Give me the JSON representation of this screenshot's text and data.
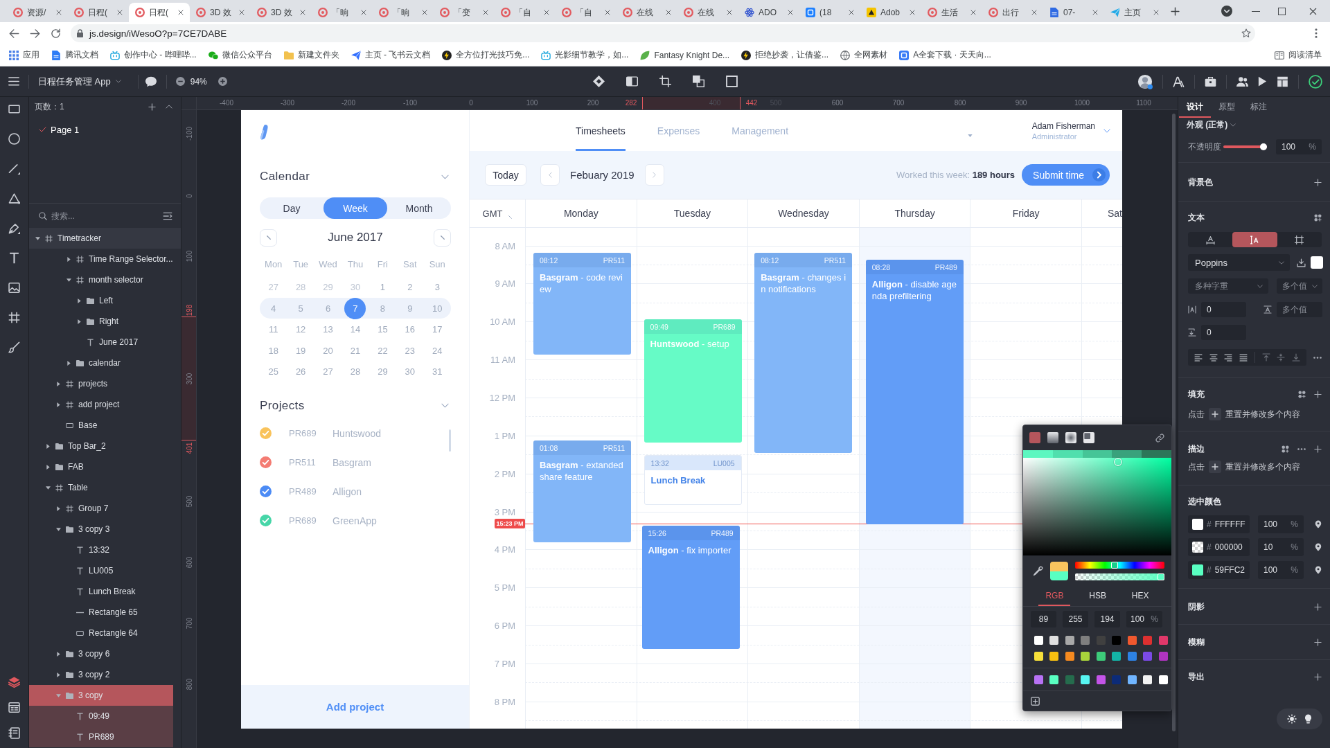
{
  "browser": {
    "tabs": [
      {
        "title": "资源/",
        "kind": "ring",
        "selected": false
      },
      {
        "title": "日程(",
        "kind": "ring",
        "selected": false
      },
      {
        "title": "日程(",
        "kind": "ring",
        "selected": true
      },
      {
        "title": "3D 效",
        "kind": "ring",
        "selected": false
      },
      {
        "title": "3D 效",
        "kind": "ring",
        "selected": false
      },
      {
        "title": "「晌",
        "kind": "ring",
        "selected": false
      },
      {
        "title": "「晌",
        "kind": "ring",
        "selected": false
      },
      {
        "title": "「变",
        "kind": "ring",
        "selected": false
      },
      {
        "title": "「自",
        "kind": "ring",
        "selected": false
      },
      {
        "title": "「自",
        "kind": "ring",
        "selected": false
      },
      {
        "title": "在线",
        "kind": "ring",
        "selected": false
      },
      {
        "title": "在线",
        "kind": "ring",
        "selected": false
      },
      {
        "title": "ADO",
        "kind": "atom",
        "selected": false
      },
      {
        "title": "(18",
        "kind": "square",
        "selected": false
      },
      {
        "title": "Adob",
        "kind": "sketch",
        "selected": false
      },
      {
        "title": "生活",
        "kind": "ring",
        "selected": false
      },
      {
        "title": "出行",
        "kind": "ring",
        "selected": false
      },
      {
        "title": "07-",
        "kind": "doc",
        "selected": false
      },
      {
        "title": "主页",
        "kind": "plane",
        "selected": false
      }
    ],
    "url": "js.design/iWesoO?p=7CE7DABE",
    "bookmarks": [
      {
        "label": "应用",
        "kind": "apps"
      },
      {
        "label": "腾讯文档",
        "kind": "doc"
      },
      {
        "label": "创作中心 - 哔哩哔...",
        "kind": "tv"
      },
      {
        "label": "微信公众平台",
        "kind": "chat"
      },
      {
        "label": "新建文件夹",
        "kind": "folder"
      },
      {
        "label": "主页 - 飞书云文档",
        "kind": "plane"
      },
      {
        "label": "全方位打光技巧免...",
        "kind": "bolt"
      },
      {
        "label": "光影细节教学，如...",
        "kind": "tv"
      },
      {
        "label": "Fantasy Knight De...",
        "kind": "leaf"
      },
      {
        "label": "拒绝抄袭，让借鉴...",
        "kind": "bolt"
      },
      {
        "label": "全网素材",
        "kind": "globe"
      },
      {
        "label": "A全套下载 · 天天向...",
        "kind": "square"
      }
    ],
    "reading_list": "阅读清单"
  },
  "app_bar": {
    "file_name": "日程任务管理 App",
    "zoom": "94%"
  },
  "panels": [
    {
      "kind": "layers",
      "selected": true
    },
    {
      "kind": "assets",
      "selected": false
    },
    {
      "kind": "notes",
      "selected": false
    }
  ],
  "layers_panel": {
    "pages_label": "页数：1",
    "pages": [
      {
        "label": "Page 1",
        "selected": true
      }
    ],
    "search_placeholder": "搜索...",
    "tree": [
      {
        "label": "Timetracker",
        "kind": "frame",
        "expanded": true,
        "selected": false,
        "children": [
          {
            "children": [
              {
                "children": [
                  {
                    "label": "Time Range Selector...",
                    "kind": "frame",
                    "expanded": false,
                    "selected": false
                  },
                  {
                    "label": "month selector",
                    "kind": "frame",
                    "expanded": true,
                    "selected": false,
                    "children": [
                      {
                        "label": "Left",
                        "kind": "folder",
                        "expanded": false,
                        "selected": false
                      },
                      {
                        "label": "Right",
                        "kind": "folder",
                        "expanded": false,
                        "selected": false
                      },
                      {
                        "label": "June 2017",
                        "kind": "text",
                        "selected": false
                      }
                    ]
                  },
                  {
                    "label": "calendar",
                    "kind": "folder",
                    "expanded": false,
                    "selected": false
                  }
                ]
              },
              {
                "label": "projects",
                "kind": "frame",
                "expanded": false,
                "selected": false
              },
              {
                "label": "add project",
                "kind": "frame",
                "expanded": false,
                "selected": false
              },
              {
                "label": "Base",
                "kind": "rectangle",
                "selected": false
              }
            ]
          },
          {
            "label": "Top Bar_2",
            "kind": "folder",
            "expanded": false,
            "selected": false
          },
          {
            "label": "FAB",
            "kind": "folder",
            "expanded": false,
            "selected": false
          },
          {
            "label": "Table",
            "kind": "frame",
            "expanded": true,
            "selected": false,
            "children": [
              {
                "label": "Group 7",
                "kind": "frame",
                "expanded": false,
                "selected": false
              },
              {
                "label": "3 copy 3",
                "kind": "folder",
                "expanded": true,
                "selected": false,
                "children": [
                  {
                    "label": "13:32",
                    "kind": "text",
                    "selected": false
                  },
                  {
                    "label": "LU005",
                    "kind": "text",
                    "selected": false
                  },
                  {
                    "label": "Lunch Break",
                    "kind": "text",
                    "selected": false
                  },
                  {
                    "label": "Rectangle 65",
                    "kind": "line",
                    "selected": false
                  },
                  {
                    "label": "Rectangle 64",
                    "kind": "rectangle",
                    "selected": false
                  }
                ]
              },
              {
                "label": "3 copy 6",
                "kind": "folder",
                "expanded": false,
                "selected": false
              },
              {
                "label": "3 copy 2",
                "kind": "folder",
                "expanded": false,
                "selected": false
              },
              {
                "label": "3 copy",
                "kind": "folder",
                "expanded": true,
                "selected": true,
                "children": [
                  {
                    "label": "09:49",
                    "kind": "text",
                    "selected": false
                  },
                  {
                    "label": "PR689",
                    "kind": "text",
                    "selected": false
                  }
                ]
              }
            ]
          }
        ]
      }
    ]
  },
  "rulers": {
    "top": [
      {
        "label": "-400",
        "kind": "tick"
      },
      {
        "label": "-300",
        "kind": "tick"
      },
      {
        "label": "-200",
        "kind": "tick"
      },
      {
        "label": "-100",
        "kind": "tick"
      },
      {
        "label": "0",
        "kind": "tick"
      },
      {
        "label": "100",
        "kind": "tick"
      },
      {
        "label": "200",
        "kind": "tick"
      },
      {
        "label": "282",
        "kind": "mark"
      },
      {
        "label": "400",
        "kind": "faint"
      },
      {
        "label": "442",
        "kind": "mark"
      },
      {
        "label": "500",
        "kind": "faint"
      },
      {
        "label": "600",
        "kind": "tick"
      },
      {
        "label": "700",
        "kind": "tick"
      },
      {
        "label": "800",
        "kind": "tick"
      },
      {
        "label": "900",
        "kind": "tick"
      },
      {
        "label": "1000",
        "kind": "tick"
      },
      {
        "label": "1100",
        "kind": "tick"
      }
    ],
    "left": [
      {
        "label": "-100",
        "kind": "tick"
      },
      {
        "label": "0",
        "kind": "tick"
      },
      {
        "label": "100",
        "kind": "tick"
      },
      {
        "label": "198",
        "kind": "mark"
      },
      {
        "label": "300",
        "kind": "tick"
      },
      {
        "label": "401",
        "kind": "mark"
      },
      {
        "label": "500",
        "kind": "tick"
      },
      {
        "label": "600",
        "kind": "tick"
      },
      {
        "label": "700",
        "kind": "tick"
      },
      {
        "label": "800",
        "kind": "tick"
      }
    ]
  },
  "artboard": {
    "sidebar": {
      "calendar_title": "Calendar",
      "views": [
        {
          "label": "Day",
          "selected": false
        },
        {
          "label": "Week",
          "selected": true
        },
        {
          "label": "Month",
          "selected": false
        }
      ],
      "month": "June 2017",
      "weekdays": [
        "Mon",
        "Tue",
        "Wed",
        "Thu",
        "Fri",
        "Sat",
        "Sun"
      ],
      "weeks": [
        {
          "selected": false,
          "days": [
            {
              "label": "27",
              "muted": true,
              "selected": false
            },
            {
              "label": "28",
              "muted": true,
              "selected": false
            },
            {
              "label": "29",
              "muted": true,
              "selected": false
            },
            {
              "label": "30",
              "muted": true,
              "selected": false
            },
            {
              "label": "1",
              "muted": false,
              "selected": false
            },
            {
              "label": "2",
              "muted": false,
              "selected": false
            },
            {
              "label": "3",
              "muted": false,
              "selected": false
            }
          ]
        },
        {
          "selected": true,
          "days": [
            {
              "label": "4",
              "muted": false,
              "selected": false
            },
            {
              "label": "5",
              "muted": false,
              "selected": false
            },
            {
              "label": "6",
              "muted": false,
              "selected": false
            },
            {
              "label": "7",
              "muted": false,
              "selected": true
            },
            {
              "label": "8",
              "muted": false,
              "selected": false
            },
            {
              "label": "9",
              "muted": false,
              "selected": false
            },
            {
              "label": "10",
              "muted": false,
              "selected": false
            }
          ]
        },
        {
          "selected": false,
          "days": [
            {
              "label": "11",
              "muted": false,
              "selected": false
            },
            {
              "label": "12",
              "muted": false,
              "selected": false
            },
            {
              "label": "13",
              "muted": false,
              "selected": false
            },
            {
              "label": "14",
              "muted": false,
              "selected": false
            },
            {
              "label": "15",
              "muted": false,
              "selected": false
            },
            {
              "label": "16",
              "muted": false,
              "selected": false
            },
            {
              "label": "17",
              "muted": false,
              "selected": false
            }
          ]
        },
        {
          "selected": false,
          "days": [
            {
              "label": "18",
              "muted": false,
              "selected": false
            },
            {
              "label": "19",
              "muted": false,
              "selected": false
            },
            {
              "label": "20",
              "muted": false,
              "selected": false
            },
            {
              "label": "21",
              "muted": false,
              "selected": false
            },
            {
              "label": "22",
              "muted": false,
              "selected": false
            },
            {
              "label": "23",
              "muted": false,
              "selected": false
            },
            {
              "label": "24",
              "muted": false,
              "selected": false
            }
          ]
        },
        {
          "selected": false,
          "days": [
            {
              "label": "25",
              "muted": false,
              "selected": false
            },
            {
              "label": "26",
              "muted": false,
              "selected": false
            },
            {
              "label": "27",
              "muted": false,
              "selected": false
            },
            {
              "label": "28",
              "muted": false,
              "selected": false
            },
            {
              "label": "29",
              "muted": false,
              "selected": false
            },
            {
              "label": "30",
              "muted": false,
              "selected": false
            },
            {
              "label": "31",
              "muted": false,
              "selected": false
            }
          ]
        }
      ],
      "projects_title": "Projects",
      "projects": [
        {
          "code": "PR689",
          "name": "Huntswood",
          "color": "#f9c35b",
          "checked": true
        },
        {
          "code": "PR511",
          "name": "Basgram",
          "color": "#f47c73",
          "checked": true
        },
        {
          "code": "PR489",
          "name": "Alligon",
          "color": "#4c8bf5",
          "checked": true
        },
        {
          "code": "PR689",
          "name": "GreenApp",
          "color": "#47d6a8",
          "checked": true
        }
      ],
      "add_project": "Add project"
    },
    "nav": [
      {
        "label": "Timesheets",
        "selected": true
      },
      {
        "label": "Expenses",
        "selected": false
      },
      {
        "label": "Management",
        "selected": false
      }
    ],
    "user": {
      "name": "Adam Fisherman",
      "role": "Administrator"
    },
    "toolbar": {
      "today": "Today",
      "period": "Febuary 2019",
      "worked": "Worked this week: **189 hours**",
      "submit": "Submit time"
    },
    "timezone": "GMT",
    "days": [
      {
        "label": "Monday",
        "current": false,
        "events": [
          {
            "kind": "project",
            "time": "08:12",
            "code": "PR511",
            "title": "**Basgram** - code review",
            "color": "#82b6f8"
          },
          {
            "kind": "project",
            "time": "01:08",
            "code": "PR511",
            "title": "**Basgram** - extanded share feature",
            "color": "#82b6f8"
          }
        ]
      },
      {
        "label": "Tuesday",
        "current": false,
        "events": [
          {
            "kind": "project",
            "time": "09:49",
            "code": "PR689",
            "title": "**Huntswood** - setup",
            "color": "#66fbc6"
          },
          {
            "kind": "break",
            "time": "13:32",
            "code": "LU005",
            "title": "Lunch Break"
          },
          {
            "kind": "project",
            "time": "15:26",
            "code": "PR489",
            "title": "**Alligon** - fix importer",
            "color": "#629df7"
          }
        ]
      },
      {
        "label": "Wednesday",
        "current": false,
        "events": [
          {
            "kind": "project",
            "time": "08:12",
            "code": "PR511",
            "title": "**Basgram** - changes in notifications",
            "color": "#82b6f8"
          }
        ]
      },
      {
        "label": "Thursday",
        "current": true,
        "events": [
          {
            "kind": "project",
            "time": "08:28",
            "code": "PR489",
            "title": "**Alligon** - disable agenda prefiltering",
            "color": "#629df7"
          }
        ]
      },
      {
        "label": "Friday",
        "current": false
      },
      {
        "label": "Sat",
        "current": false
      }
    ],
    "hours": [
      "8 AM",
      "9 AM",
      "10 AM",
      "11 AM",
      "12 PM",
      "1 PM",
      "2 PM",
      "3 PM",
      "4 PM",
      "5 PM",
      "6 PM",
      "7 PM",
      "8 PM"
    ],
    "now": "15:23 PM"
  },
  "color_picker": {
    "fill_types": [
      {
        "kind": "solid",
        "selected": true
      },
      {
        "kind": "linear",
        "selected": false
      },
      {
        "kind": "radial",
        "selected": false
      },
      {
        "kind": "image",
        "selected": false
      }
    ],
    "shades": [
      {
        "color": "#5cf7c0"
      },
      {
        "color": "#50dfad"
      },
      {
        "color": "#45c597"
      },
      {
        "color": "#39a27c"
      },
      {
        "color": "#2c7759"
      }
    ],
    "saturation": {
      "level": 0.65
    },
    "previous_color": {
      "color": "#f9c45e"
    },
    "current_color": {
      "color": "#59ffc2"
    },
    "hue": {
      "level": 0.44
    },
    "alpha": {
      "level": 1
    },
    "modes": [
      {
        "label": "RGB",
        "selected": true
      },
      {
        "label": "HSB",
        "selected": false
      },
      {
        "label": "HEX",
        "selected": false
      }
    ],
    "values": [
      "89",
      "255",
      "194",
      "100"
    ],
    "unit": "%",
    "swatches": [
      {
        "color": "#ffffff"
      },
      {
        "color": "#e0e0e0"
      },
      {
        "color": "#a8a8a8"
      },
      {
        "color": "#7f7f7f"
      },
      {
        "color": "#404040"
      },
      {
        "color": "#000000"
      },
      {
        "color": "#f0582e"
      },
      {
        "color": "#dd3030"
      },
      {
        "color": "#e0386a"
      },
      {
        "color": "#f7e03a"
      },
      {
        "color": "#f8c010"
      },
      {
        "color": "#f58a1f"
      },
      {
        "color": "#a8d43b"
      },
      {
        "color": "#3dcc7a"
      },
      {
        "color": "#13b3a6"
      },
      {
        "color": "#2d82e4"
      },
      {
        "color": "#7b4ae6"
      },
      {
        "color": "#b034c0"
      }
    ],
    "custom_swatches": [
      {
        "color": "#b872f5"
      },
      {
        "color": "#59ffc2"
      },
      {
        "color": "#256c4d"
      },
      {
        "color": "#57f5f2"
      },
      {
        "color": "#c454e8"
      },
      {
        "color": "#0c2b78"
      },
      {
        "color": "#70b5ff"
      },
      {
        "color": "#f2f2f2"
      },
      {
        "color": "#ffffff"
      }
    ]
  },
  "inspector": {
    "tabs": [
      {
        "label": "设计",
        "selected": true
      },
      {
        "label": "原型",
        "selected": false
      },
      {
        "label": "标注",
        "selected": false
      }
    ],
    "appearance": "外观 (正常)",
    "opacity": {
      "label": "不透明度",
      "level": 1,
      "value": "100",
      "unit": "%"
    },
    "background_title": "背景色",
    "text": {
      "title": "文本",
      "modes": [
        {
          "kind": "width",
          "selected": false
        },
        {
          "kind": "height",
          "selected": true
        },
        {
          "kind": "fixed",
          "selected": false
        }
      ],
      "font": "Poppins",
      "swatch": {
        "color": "#ffffff"
      },
      "weight": "多种字重",
      "size": "多个值",
      "letter_spacing": "0",
      "line_height": "多个值",
      "paragraph_spacing": "0"
    },
    "fill": {
      "title": "填充",
      "hint_action": "点击",
      "hint": "重置并修改多个内容"
    },
    "stroke": {
      "title": "描边",
      "hint_action": "点击",
      "hint": "重置并修改多个内容"
    },
    "selected_colors": {
      "title": "选中颜色",
      "items": [
        {
          "kind": "solid",
          "color": "#ffffff",
          "prefix": "#",
          "hex": "FFFFFF",
          "opacity": "100",
          "unit": "%"
        },
        {
          "kind": "checker",
          "prefix": "#",
          "hex": "000000",
          "opacity": "10",
          "unit": "%"
        },
        {
          "kind": "solid",
          "color": "#59ffc2",
          "prefix": "#",
          "hex": "59FFC2",
          "opacity": "100",
          "unit": "%"
        }
      ]
    },
    "shadow_title": "阴影",
    "blur_title": "模糊",
    "export_title": "导出"
  }
}
